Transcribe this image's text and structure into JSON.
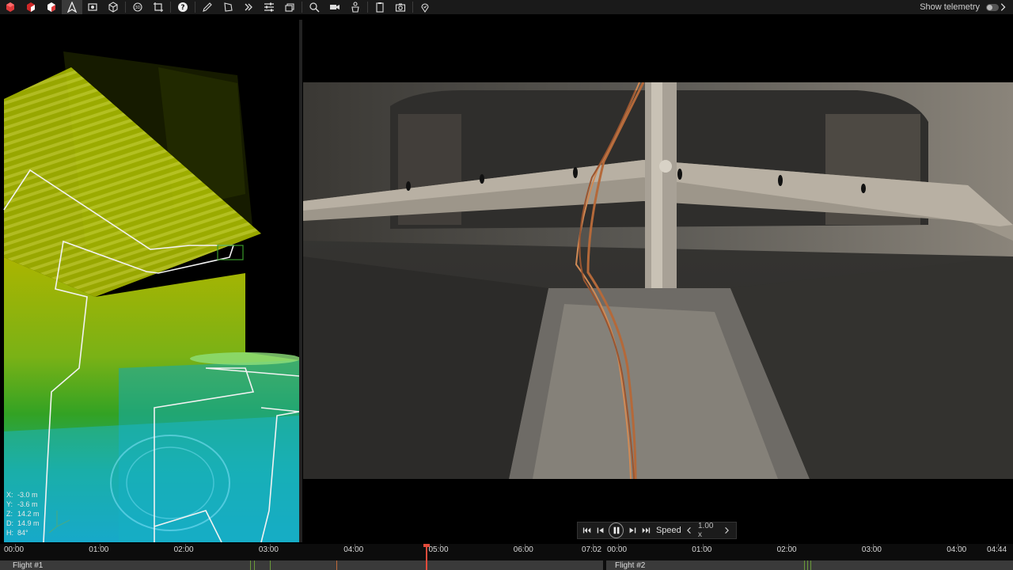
{
  "toolbar": {
    "icons": [
      "cube-red-icon",
      "cube-red-icon",
      "cube-red-white-icon",
      "navigate-icon",
      "camera-frame-icon",
      "box-3d-icon",
      "rotate-3d-icon",
      "crop-icon",
      "help-icon",
      "pencil-icon",
      "polygon-icon",
      "chevron-double-right-icon",
      "sliders-icon",
      "layers-icon",
      "zoom-icon",
      "video-camera-icon",
      "anchor-person-icon",
      "clipboard-icon",
      "camera-icon",
      "location-pin-icon"
    ],
    "show_telemetry_label": "Show telemetry",
    "accent_red": "#e03a3a"
  },
  "point_cloud": {
    "coords": [
      {
        "k": "X:",
        "v": "-3.0 m"
      },
      {
        "k": "Y:",
        "v": "-3.6 m"
      },
      {
        "k": "Z:",
        "v": "14.2 m"
      },
      {
        "k": "D:",
        "v": "14.9 m"
      },
      {
        "k": "H:",
        "v": "84°"
      }
    ]
  },
  "playback": {
    "speed_label": "Speed",
    "speed_value": "1.00 x"
  },
  "timeline": {
    "flight1": {
      "name": "Flight #1",
      "ticks": [
        "00:00",
        "01:00",
        "02:00",
        "03:00",
        "04:00",
        "05:00",
        "06:00",
        "07:02"
      ]
    },
    "flight2": {
      "name": "Flight #2",
      "ticks": [
        "00:00",
        "01:00",
        "02:00",
        "03:00",
        "04:00",
        "04:44"
      ]
    }
  }
}
